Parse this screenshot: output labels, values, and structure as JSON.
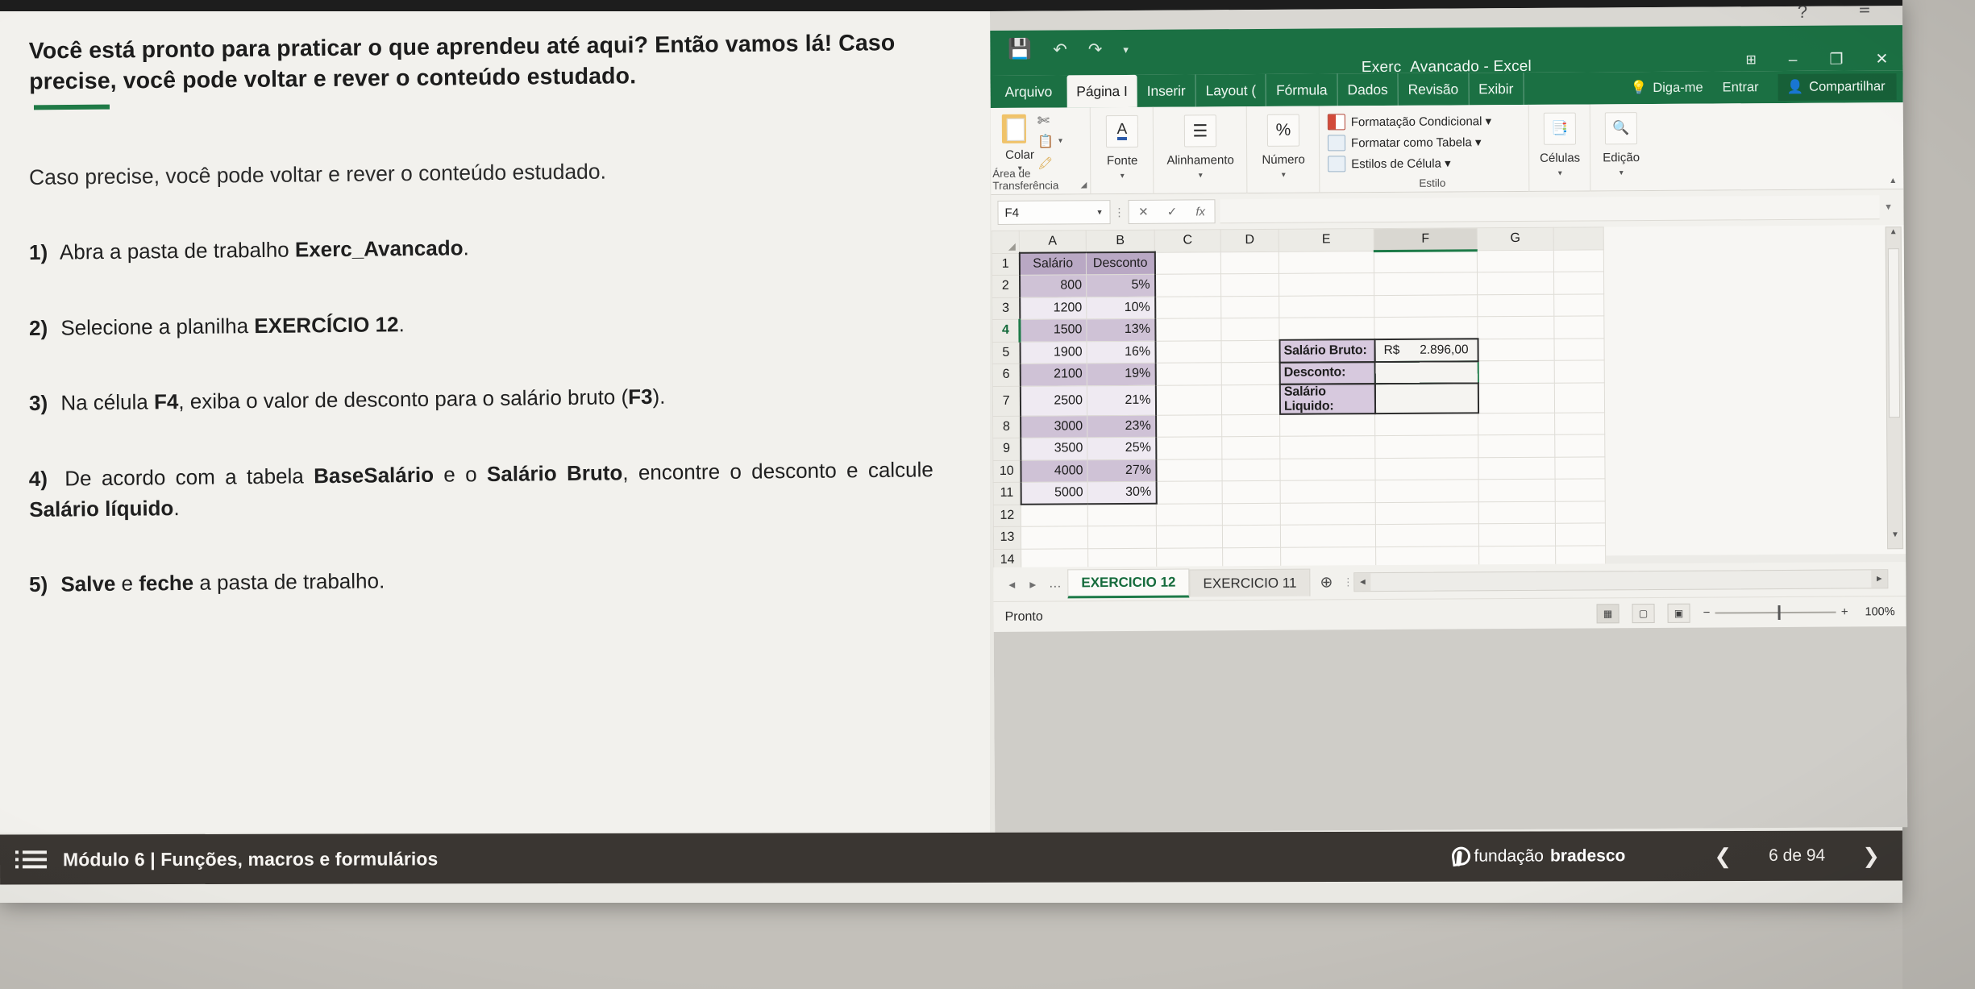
{
  "slide": {
    "intro": "Você está pronto para praticar o que aprendeu até aqui? Então vamos lá! Caso precise, você pode voltar e rever o conteúdo estudado.",
    "subtitle": "Caso precise, você pode voltar e rever o conteúdo estudado.",
    "steps": [
      {
        "num": "1)",
        "text_before": " Abra a pasta de trabalho ",
        "bold1": "Exerc_Avancado",
        "text_after": "."
      },
      {
        "num": "2)",
        "text_before": " Selecione a planilha ",
        "bold1": "EXERCÍCIO 12",
        "text_after": "."
      },
      {
        "num": "3)",
        "text_before": " Na célula ",
        "bold1": "F4",
        "text_mid": ", exiba o valor de desconto para o salário bruto (",
        "bold2": "F3",
        "text_after": ")."
      },
      {
        "num": "4)",
        "text_before": " De acordo com a tabela ",
        "bold1": "BaseSalário",
        "text_mid": " e o ",
        "bold2": "Salário Bruto",
        "text_mid2": ", encontre o desconto e calcule ",
        "bold3": "Salário líquido",
        "text_after": "."
      },
      {
        "num": "5)",
        "bold1": " Salve",
        "text_mid": " e ",
        "bold2": "feche",
        "text_after": " a pasta de trabalho."
      }
    ]
  },
  "excel": {
    "title": "Exerc_Avancado - Excel",
    "quick_access": [
      "save-icon",
      "undo-icon",
      "redo-icon",
      "customize-icon"
    ],
    "help_icon": "?",
    "ribbon_display_icon": "≡",
    "window_buttons": {
      "ribbon_options": "⊞",
      "minimize": "–",
      "maximize": "❐",
      "close": "✕"
    },
    "tabs": [
      {
        "label": "Arquivo",
        "active": false,
        "first": true
      },
      {
        "label": "Página I",
        "active": true
      },
      {
        "label": "Inserir",
        "active": false
      },
      {
        "label": "Layout (",
        "active": false
      },
      {
        "label": "Fórmula",
        "active": false
      },
      {
        "label": "Dados",
        "active": false
      },
      {
        "label": "Revisão",
        "active": false
      },
      {
        "label": "Exibir",
        "active": false
      }
    ],
    "tell_me": "Diga-me",
    "sign_in": "Entrar",
    "share": "Compartilhar",
    "ribbon_groups": [
      {
        "name": "Colar",
        "label": "Área de Transferência",
        "icon": "clipboard-icon"
      },
      {
        "name": "Fonte",
        "label": "",
        "icon": "font-color-icon"
      },
      {
        "name": "Alinhamento",
        "label": "",
        "icon": "align-icon"
      },
      {
        "name": "Número",
        "label": "",
        "icon": "percent-icon"
      },
      {
        "name": "",
        "label": "Estilo",
        "icon": ""
      },
      {
        "name": "Células",
        "label": "",
        "icon": "cells-icon"
      },
      {
        "name": "Edição",
        "label": "",
        "icon": "find-icon"
      }
    ],
    "style_items": [
      "Formatação Condicional ▾",
      "Formatar como Tabela ▾",
      "Estilos de Célula ▾"
    ],
    "group_label_clipboard": "Área de Transferência",
    "group_label_style": "Estilo",
    "formula_bar": {
      "name_box": "F4",
      "cancel_icon": "✕",
      "confirm_icon": "✓",
      "fx_icon": "fx",
      "value": ""
    },
    "columns": [
      "A",
      "B",
      "C",
      "D",
      "E",
      "F",
      "G"
    ],
    "selected_column": "F",
    "selected_row": "4",
    "rows": [
      "1",
      "2",
      "3",
      "4",
      "5",
      "6",
      "7",
      "8",
      "9",
      "10",
      "11",
      "12",
      "13",
      "14"
    ],
    "base_table": {
      "headers": [
        "Salário",
        "Desconto"
      ],
      "rows": [
        [
          "800",
          "5%"
        ],
        [
          "1200",
          "10%"
        ],
        [
          "1500",
          "13%"
        ],
        [
          "1900",
          "16%"
        ],
        [
          "2100",
          "19%"
        ],
        [
          "2500",
          "21%"
        ],
        [
          "3000",
          "23%"
        ],
        [
          "3500",
          "25%"
        ],
        [
          "4000",
          "27%"
        ],
        [
          "5000",
          "30%"
        ]
      ]
    },
    "calc_box": {
      "labels": [
        "Salário Bruto:",
        "Desconto:",
        "Salário Liquido:"
      ],
      "values": [
        {
          "currency": "R$",
          "amount": "2.896,00"
        },
        {
          "currency": "",
          "amount": ""
        },
        {
          "currency": "",
          "amount": ""
        }
      ]
    },
    "sheet_tabs": [
      {
        "label": "EXERCICIO 12",
        "active": true
      },
      {
        "label": "EXERCICIO 11",
        "active": false
      }
    ],
    "add_sheet_icon": "⊕",
    "status": "Pronto",
    "view_buttons": [
      "normal-view-icon",
      "page-layout-icon",
      "page-break-icon"
    ],
    "zoom": "100%"
  },
  "navbar": {
    "menu_icon": "list-menu-icon",
    "title": "Módulo 6 | Funções, macros e formulários",
    "brand_light": "fundação",
    "brand_bold": "bradesco",
    "prev_icon": "❮",
    "next_icon": "❯",
    "page_counter": "6 de 94"
  },
  "colors": {
    "excel_green": "#1b7043",
    "accent_green": "#1d7a48",
    "table_header_purple": "#b9a8c4",
    "table_band_purple": "#cfc2d6",
    "label_purple": "#d7c9de",
    "navbar_dark": "#3a3632"
  }
}
